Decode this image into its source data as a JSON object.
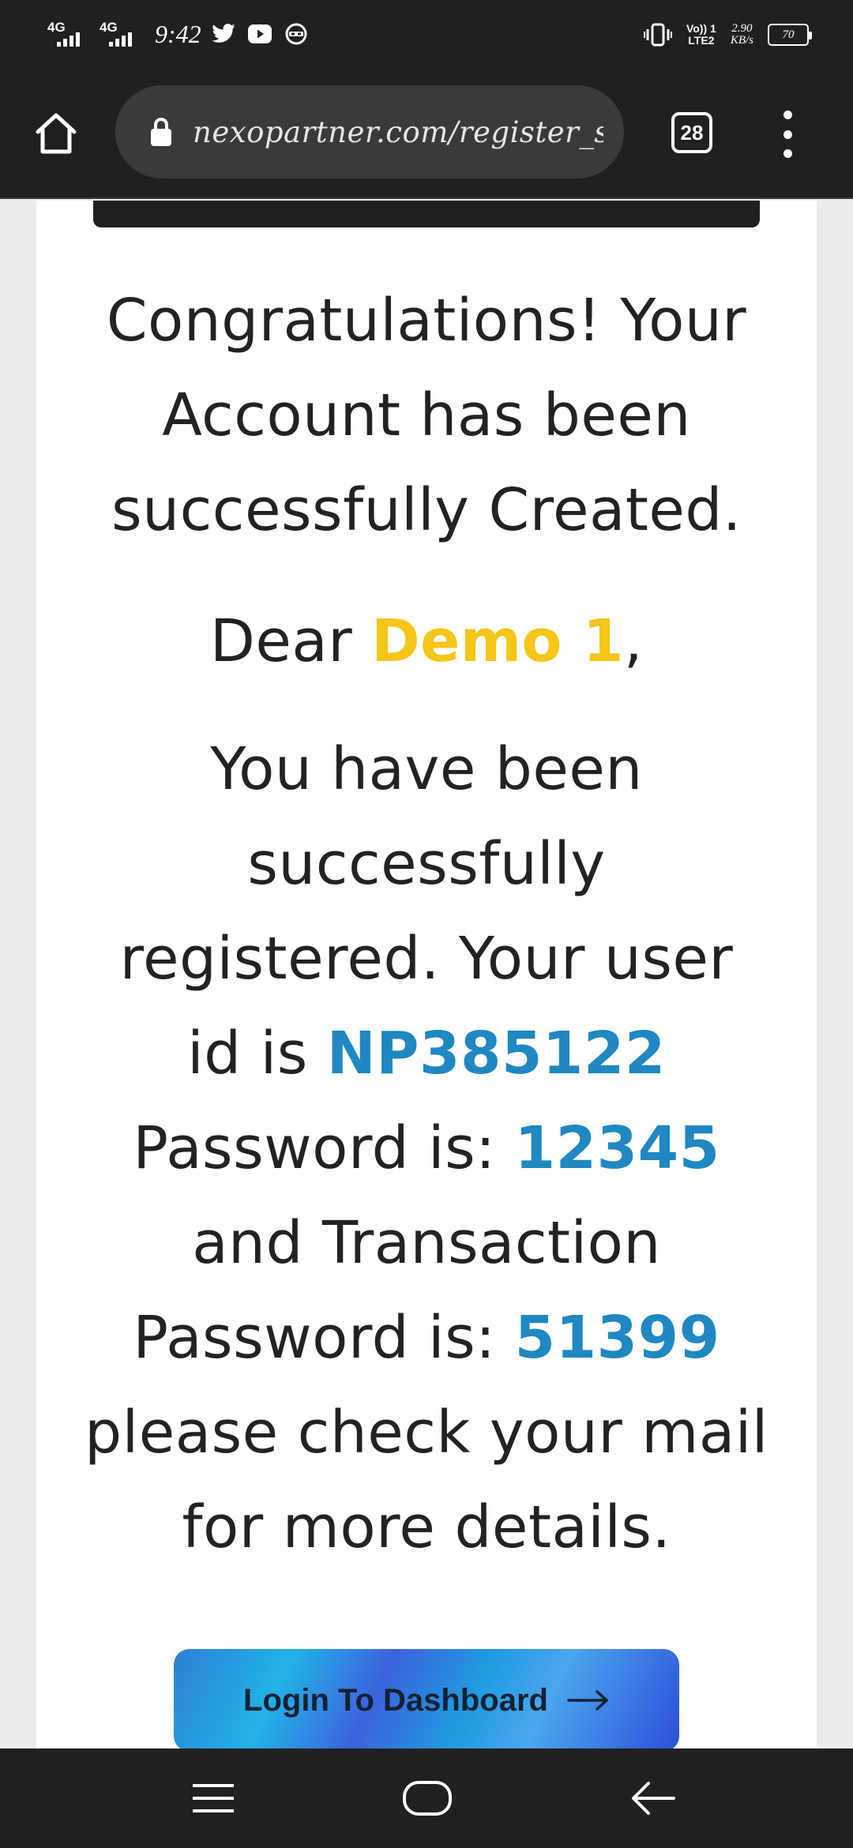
{
  "status_bar": {
    "network_1": "4G",
    "network_2": "4G",
    "time": "9:42",
    "volte_line1": "Vo)) 1",
    "volte_line2": "LTE2",
    "speed_value": "2.90",
    "speed_unit": "KB/s",
    "battery": "70"
  },
  "browser": {
    "url": "nexopartner.com/register_success",
    "tab_count": "28"
  },
  "page": {
    "congrats_line1": "Congratulations! Your",
    "congrats_line2": "Account has been",
    "congrats_line3": "successfully Created.",
    "dear_prefix": "Dear ",
    "user_name": "Demo 1",
    "dear_suffix": ",",
    "msg_line1": "You have been",
    "msg_line2": "successfully",
    "msg_line3": "registered. Your user",
    "msg_userid_prefix": "id is ",
    "user_id": "NP385122",
    "msg_password_prefix": "Password is: ",
    "password": "12345",
    "msg_line6": "and Transaction",
    "msg_txn_prefix": "Password is: ",
    "transaction_password": "51399",
    "msg_line8": "please check your mail",
    "msg_line9": "for more details.",
    "login_button_label": "Login To Dashboard"
  },
  "colors": {
    "highlight_name": "#f5c518",
    "highlight_value": "#1f87c2",
    "toolbar_bg": "#202020"
  }
}
